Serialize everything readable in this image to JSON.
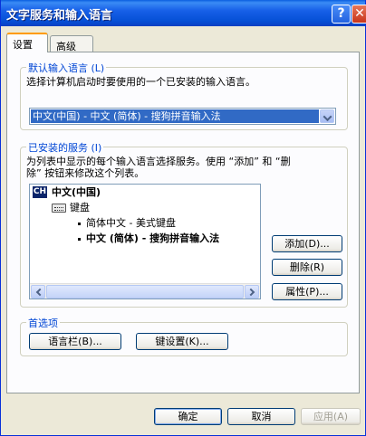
{
  "window": {
    "title": "文字服务和输入语言"
  },
  "titlebar": {
    "help_label": "?",
    "close_label": "✕"
  },
  "tabs": [
    {
      "label": "设置",
      "active": true
    },
    {
      "label": "高级",
      "active": false
    }
  ],
  "default_language": {
    "group_label": "默认输入语言 (L)",
    "description": "选择计算机启动时要使用的一个已安装的输入语言。",
    "selected": "中文(中国) - 中文 (简体) - 搜狗拼音输入法"
  },
  "installed_services": {
    "group_label": "已安装的服务 (I)",
    "description_line1": "为列表中显示的每个输入语言选择服务。使用 “添加” 和 “删",
    "description_line2": "除” 按钮来修改这个列表。",
    "tree": {
      "language_badge": "CH",
      "language": "中文(中国)",
      "category": "键盘",
      "items": [
        "简体中文 - 美式键盘",
        "中文 (简体) - 搜狗拼音输入法"
      ]
    },
    "buttons": {
      "add": "添加(D)...",
      "remove": "删除(R)",
      "properties": "属性(P)..."
    }
  },
  "preferences": {
    "group_label": "首选项",
    "language_bar": "语言栏(B)...",
    "key_settings": "键设置(K)..."
  },
  "footer": {
    "ok": "确定",
    "cancel": "取消",
    "apply": "应用(A)"
  },
  "colors": {
    "selection": "#316ac5",
    "titlebar": "#0650d6",
    "group_label": "#0046d5"
  }
}
